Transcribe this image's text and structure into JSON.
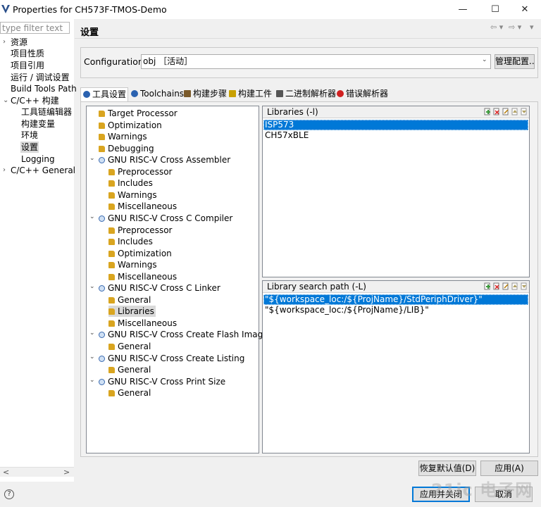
{
  "window": {
    "title": "Properties for CH573F-TMOS-Demo",
    "minimize": "—",
    "maximize": "☐",
    "close": "✕"
  },
  "left_nav": {
    "filter_placeholder": "type filter text",
    "items": [
      {
        "label": "资源",
        "arrow": "›"
      },
      {
        "label": "项目性质"
      },
      {
        "label": "项目引用"
      },
      {
        "label": "运行 / 调试设置"
      },
      {
        "label": "Build Tools Path"
      },
      {
        "label": "C/C++ 构建",
        "arrow": "⌄"
      },
      {
        "label": "工具链编辑器"
      },
      {
        "label": "构建变量"
      },
      {
        "label": "环境"
      },
      {
        "label": "设置",
        "selected": true
      },
      {
        "label": "Logging"
      },
      {
        "label": "C/C++ General",
        "arrow": "›"
      }
    ],
    "scroll_left": "<",
    "scroll_right": ">"
  },
  "header": {
    "title": "设置",
    "nav_back": "⇦ ▾",
    "nav_fwd": "⇨ ▾",
    "menu": "▾"
  },
  "config": {
    "label": "Configuration:",
    "value": "obj ［活动］",
    "manage_button": "管理配置..."
  },
  "tabs": [
    {
      "label": "工具设置",
      "active": true,
      "icon": "settings-icon"
    },
    {
      "label": "Toolchains",
      "icon": "toolchain-icon"
    },
    {
      "label": "构建步骤",
      "icon": "wrench-icon"
    },
    {
      "label": "构建工件",
      "icon": "artifact-icon"
    },
    {
      "label": "二进制解析器",
      "icon": "binary-icon"
    },
    {
      "label": "错误解析器",
      "icon": "error-icon"
    }
  ],
  "tool_tree": [
    {
      "label": "Target Processor",
      "level": 1
    },
    {
      "label": "Optimization",
      "level": 1
    },
    {
      "label": "Warnings",
      "level": 1
    },
    {
      "label": "Debugging",
      "level": 1
    },
    {
      "label": "GNU RISC-V Cross Assembler",
      "level": 0
    },
    {
      "label": "Preprocessor",
      "level": 2
    },
    {
      "label": "Includes",
      "level": 2
    },
    {
      "label": "Warnings",
      "level": 2
    },
    {
      "label": "Miscellaneous",
      "level": 2
    },
    {
      "label": "GNU RISC-V Cross C Compiler",
      "level": 0
    },
    {
      "label": "Preprocessor",
      "level": 2
    },
    {
      "label": "Includes",
      "level": 2
    },
    {
      "label": "Optimization",
      "level": 2
    },
    {
      "label": "Warnings",
      "level": 2
    },
    {
      "label": "Miscellaneous",
      "level": 2
    },
    {
      "label": "GNU RISC-V Cross C Linker",
      "level": 0
    },
    {
      "label": "General",
      "level": 2
    },
    {
      "label": "Libraries",
      "level": 2,
      "selected": true
    },
    {
      "label": "Miscellaneous",
      "level": 2
    },
    {
      "label": "GNU RISC-V Cross Create Flash Image",
      "level": 0
    },
    {
      "label": "General",
      "level": 2
    },
    {
      "label": "GNU RISC-V Cross Create Listing",
      "level": 0
    },
    {
      "label": "General",
      "level": 2
    },
    {
      "label": "GNU RISC-V Cross Print Size",
      "level": 0
    },
    {
      "label": "General",
      "level": 2
    }
  ],
  "libraries": {
    "title": "Libraries (-l)",
    "items": [
      "ISP573",
      "CH57xBLE"
    ],
    "selected_index": 0
  },
  "library_paths": {
    "title": "Library search path (-L)",
    "items": [
      "\"${workspace_loc:/${ProjName}/StdPeriphDriver}\"",
      "\"${workspace_loc:/${ProjName}/LIB}\""
    ],
    "selected_index": 0
  },
  "buttons": {
    "restore_defaults": "恢复默认值(D)",
    "apply": "应用(A)",
    "apply_close": "应用并关闭",
    "cancel": "取消"
  },
  "help": "?",
  "watermark": "21ic 电子网",
  "colors": {
    "selection": "#0078d7",
    "tree_selected": "#d9d9d9"
  }
}
